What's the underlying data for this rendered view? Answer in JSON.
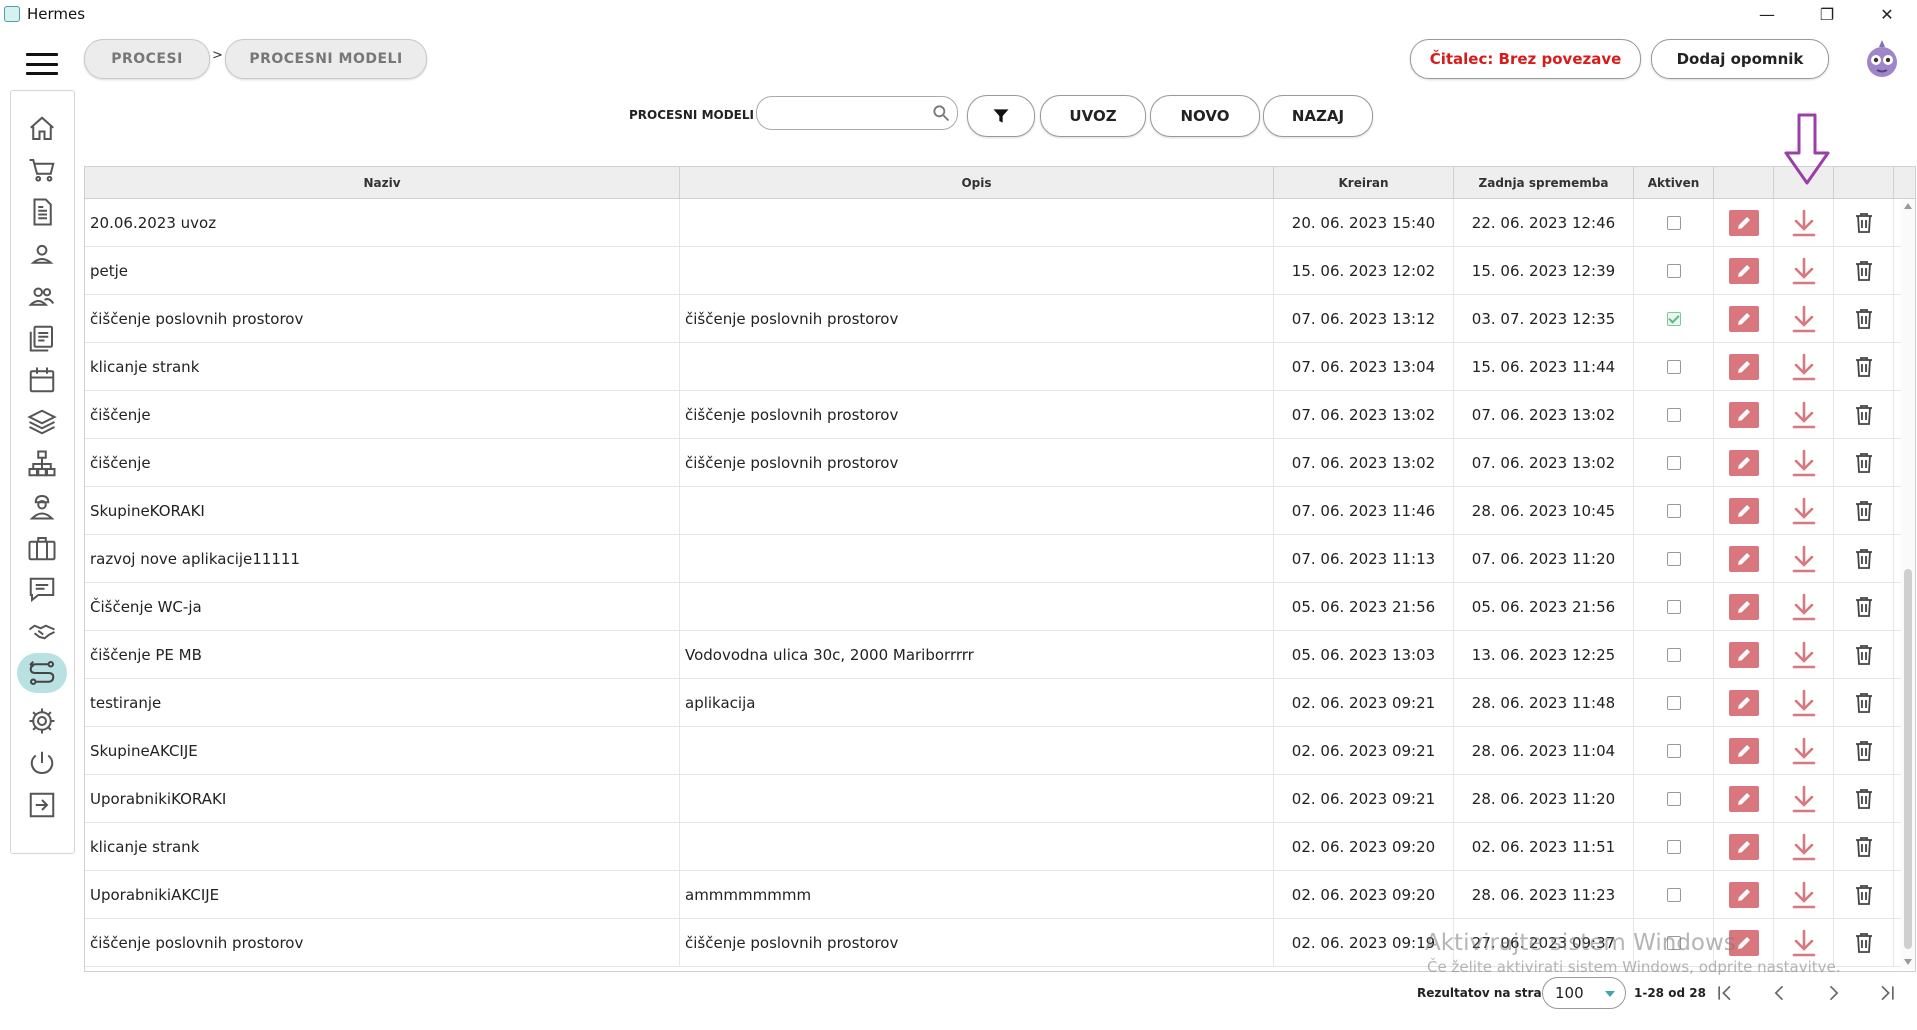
{
  "window": {
    "title": "Hermes",
    "controls": [
      "—",
      "❐",
      "✕"
    ]
  },
  "breadcrumb": {
    "items": [
      "PROCESI",
      "PROCESNI MODELI"
    ],
    "separator": ">"
  },
  "header": {
    "status_label": "Čitalec: Brez povezave",
    "reminder_label": "Dodaj opomnik"
  },
  "toolbar": {
    "label": "PROCESNI MODELI",
    "search_value": "",
    "buttons": {
      "import": "UVOZ",
      "new": "NOVO",
      "back": "NAZAJ"
    }
  },
  "sidebar": {
    "items": [
      "home-icon",
      "cart-icon",
      "document-icon",
      "user-icon",
      "users-icon",
      "list-icon",
      "calendar-icon",
      "layers-icon",
      "org-chart-icon",
      "worker-icon",
      "briefcase-icon",
      "chat-icon",
      "handshake-icon",
      "process-icon",
      "gear-icon",
      "power-icon",
      "exit-icon"
    ],
    "active": "process-icon"
  },
  "table": {
    "columns": {
      "name": "Naziv",
      "desc": "Opis",
      "created": "Kreiran",
      "modified": "Zadnja sprememba",
      "active": "Aktiven"
    },
    "rows": [
      {
        "name": "20.06.2023 uvoz",
        "desc": "",
        "created": "20. 06. 2023 15:40",
        "modified": "22. 06. 2023 12:46",
        "active": false
      },
      {
        "name": "petje",
        "desc": "",
        "created": "15. 06. 2023 12:02",
        "modified": "15. 06. 2023 12:39",
        "active": false
      },
      {
        "name": "čiščenje poslovnih prostorov",
        "desc": "čiščenje poslovnih prostorov",
        "created": "07. 06. 2023 13:12",
        "modified": "03. 07. 2023 12:35",
        "active": true
      },
      {
        "name": "klicanje strank",
        "desc": "",
        "created": "07. 06. 2023 13:04",
        "modified": "15. 06. 2023 11:44",
        "active": false
      },
      {
        "name": "čiščenje",
        "desc": "čiščenje poslovnih prostorov",
        "created": "07. 06. 2023 13:02",
        "modified": "07. 06. 2023 13:02",
        "active": false
      },
      {
        "name": "čiščenje",
        "desc": "čiščenje poslovnih prostorov",
        "created": "07. 06. 2023 13:02",
        "modified": "07. 06. 2023 13:02",
        "active": false
      },
      {
        "name": "SkupineKORAKI",
        "desc": "",
        "created": "07. 06. 2023 11:46",
        "modified": "28. 06. 2023 10:45",
        "active": false
      },
      {
        "name": "razvoj nove aplikacije11111",
        "desc": "",
        "created": "07. 06. 2023 11:13",
        "modified": "07. 06. 2023 11:20",
        "active": false
      },
      {
        "name": "Čiščenje WC-ja",
        "desc": "",
        "created": "05. 06. 2023 21:56",
        "modified": "05. 06. 2023 21:56",
        "active": false
      },
      {
        "name": "čiščenje PE MB",
        "desc": "Vodovodna ulica 30c, 2000 Mariborrrrr",
        "created": "05. 06. 2023 13:03",
        "modified": "13. 06. 2023 12:25",
        "active": false
      },
      {
        "name": "testiranje",
        "desc": "aplikacija",
        "created": "02. 06. 2023 09:21",
        "modified": "28. 06. 2023 11:48",
        "active": false
      },
      {
        "name": "SkupineAKCIJE",
        "desc": "",
        "created": "02. 06. 2023 09:21",
        "modified": "28. 06. 2023 11:04",
        "active": false
      },
      {
        "name": "UporabnikiKORAKI",
        "desc": "",
        "created": "02. 06. 2023 09:21",
        "modified": "28. 06. 2023 11:20",
        "active": false
      },
      {
        "name": "klicanje strank",
        "desc": "",
        "created": "02. 06. 2023 09:20",
        "modified": "02. 06. 2023 11:51",
        "active": false
      },
      {
        "name": "UporabnikiAKCIJE",
        "desc": "ammmmmmmm",
        "created": "02. 06. 2023 09:20",
        "modified": "28. 06. 2023 11:23",
        "active": false
      },
      {
        "name": "čiščenje poslovnih prostorov",
        "desc": "čiščenje poslovnih prostorov",
        "created": "02. 06. 2023 09:19",
        "modified": "27. 06. 2023 09:37",
        "active": false
      }
    ]
  },
  "pagination": {
    "label": "Rezultatov na stran",
    "page_size": "100",
    "range": "1-28 od 28",
    "nav": [
      "|<",
      "<",
      ">",
      ">|"
    ]
  },
  "watermark": {
    "line1": "Aktivirajte sistem Windows",
    "line2": "Če želite aktivirati sistem Windows, odprite nastavitve."
  },
  "colors": {
    "accent": "#b9e1e2",
    "edit": "#d9777e",
    "annotation": "#9b3fa8",
    "status": "#d81b1b"
  }
}
